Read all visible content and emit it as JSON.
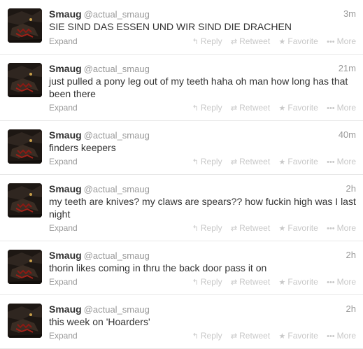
{
  "tweets": [
    {
      "name": "Smaug",
      "handle": "@actual_smaug",
      "time": "3m",
      "text": "SIE SIND DAS ESSEN UND WIR SIND DIE DRACHEN",
      "expand": "Expand",
      "reply": "Reply",
      "retweet": "Retweet",
      "favorite": "Favorite",
      "more": "More"
    },
    {
      "name": "Smaug",
      "handle": "@actual_smaug",
      "time": "21m",
      "text": "just pulled a pony leg out of my teeth haha oh man how long has that been there",
      "expand": "Expand",
      "reply": "Reply",
      "retweet": "Retweet",
      "favorite": "Favorite",
      "more": "More"
    },
    {
      "name": "Smaug",
      "handle": "@actual_smaug",
      "time": "40m",
      "text": "finders keepers",
      "expand": "Expand",
      "reply": "Reply",
      "retweet": "Retweet",
      "favorite": "Favorite",
      "more": "More"
    },
    {
      "name": "Smaug",
      "handle": "@actual_smaug",
      "time": "2h",
      "text": "my teeth are knives? my claws are spears?? how fuckin high was I last night",
      "expand": "Expand",
      "reply": "Reply",
      "retweet": "Retweet",
      "favorite": "Favorite",
      "more": "More"
    },
    {
      "name": "Smaug",
      "handle": "@actual_smaug",
      "time": "2h",
      "text": "thorin likes coming in thru the back door pass it on",
      "expand": "Expand",
      "reply": "Reply",
      "retweet": "Retweet",
      "favorite": "Favorite",
      "more": "More"
    },
    {
      "name": "Smaug",
      "handle": "@actual_smaug",
      "time": "2h",
      "text": "this week on 'Hoarders'",
      "expand": "Expand",
      "reply": "Reply",
      "retweet": "Retweet",
      "favorite": "Favorite",
      "more": "More"
    }
  ],
  "icons": {
    "reply": "reply-arrow-icon",
    "retweet": "retweet-arrows-icon",
    "favorite": "star-icon",
    "more": "dots-icon"
  },
  "colors": {
    "text": "#333333",
    "muted": "#999999",
    "action": "#c8c8c8",
    "divider": "#e8e8e8"
  }
}
